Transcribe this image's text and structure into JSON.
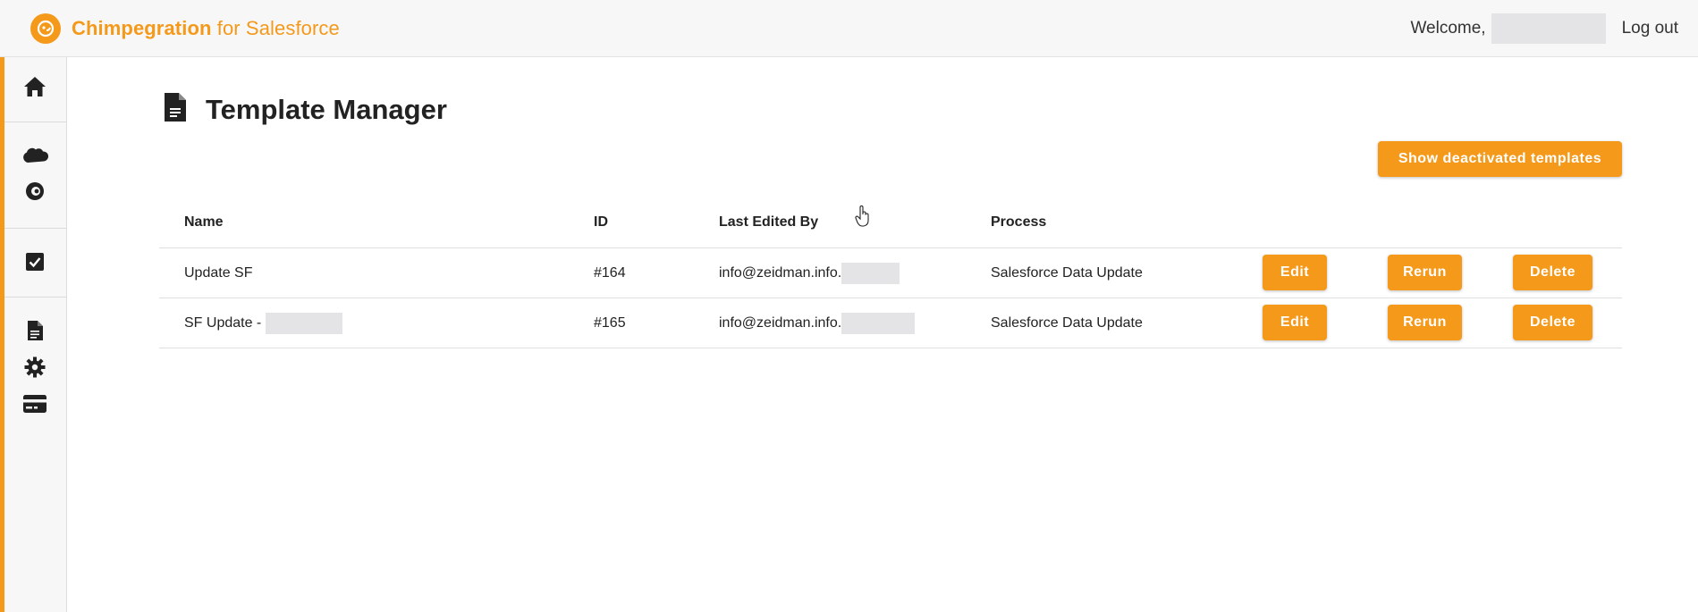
{
  "header": {
    "brand_bold": "Chimpegration",
    "brand_rest": " for Salesforce",
    "welcome": "Welcome,",
    "logout": "Log out",
    "accent_color": "#f4991a"
  },
  "sidebar": {
    "icons": [
      "home-icon",
      "salesforce-cloud-icon",
      "mailchimp-icon",
      "checkbox-icon",
      "document-icon",
      "gear-icon",
      "credit-card-icon"
    ]
  },
  "main": {
    "title": "Template Manager",
    "show_deactivated_label": "Show deactivated templates",
    "table": {
      "columns": [
        "Name",
        "ID",
        "Last Edited By",
        "Process"
      ],
      "rows": [
        {
          "name": "Update SF",
          "id": "#164",
          "last_edited_by": "info@zeidman.info.",
          "process": "Salesforce Data Update"
        },
        {
          "name": "SF Update - ",
          "id": "#165",
          "last_edited_by": "info@zeidman.info.",
          "process": "Salesforce Data Update"
        }
      ],
      "actions": {
        "edit": "Edit",
        "rerun": "Rerun",
        "delete": "Delete"
      }
    }
  }
}
